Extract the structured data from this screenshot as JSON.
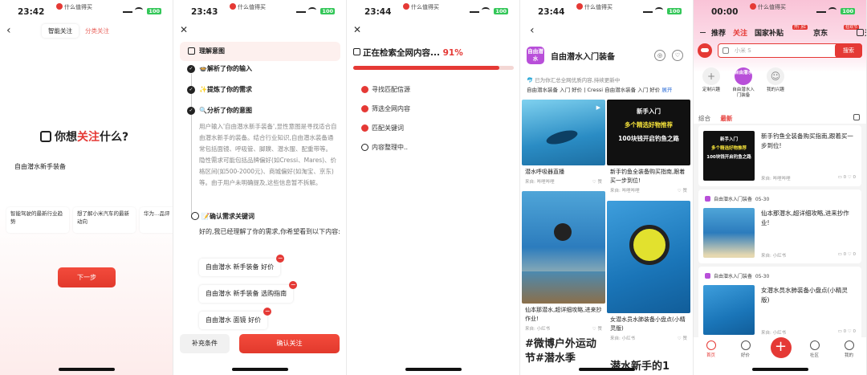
{
  "status_bar": {
    "app": "什么值得买",
    "battery": "100",
    "signal": "5G"
  },
  "screen1": {
    "time": "23:42",
    "tab_active": "智能关注",
    "tab_inactive": "分类关注",
    "heading_pre": "你想",
    "heading_hl": "关注",
    "heading_post": "什么?",
    "input_value": "自由潜水新手装备",
    "chips": [
      "智能驾驶的最新行业趋势",
      "想了解小米汽车的最新动向",
      "华为…品评"
    ],
    "next_label": "下一步"
  },
  "screen2": {
    "time": "23:43",
    "header": "理解意图",
    "step1": "🍲解析了你的输入",
    "step2": "✨提炼了你的需求",
    "step3": "🔍分析了你的意图",
    "desc": "用户输入'自由潜水新手装备',显性意图是寻找适合自由潜水新手的装备。结合行业知识,自由潜水装备通常包括面镜、呼吸管、脚蹼、潜水服、配重带等。隐性需求可能包括品牌偏好(如Cressi、Mares)、价格区间(如500-2000元)、商城偏好(如淘宝、京东)等。由于用户未明确提及,这些信息暂不拆解。",
    "confirm_title": "📝确认需求关键词",
    "confirm_text": "好的,我已经理解了你的需求,你希望看到以下内容:",
    "keywords": [
      "自由潜水 新手装备 好价",
      "自由潜水 新手装备 选购指南",
      "自由潜水 面镜 好价"
    ],
    "add_label": "补充条件",
    "confirm_label": "确认关注"
  },
  "screen3": {
    "time": "23:44",
    "heading": "正在检索全网内容...",
    "percent": "91%",
    "progress": 0.91,
    "items": [
      {
        "label": "寻找匹配信源",
        "done": true
      },
      {
        "label": "筛选全网内容",
        "done": true
      },
      {
        "label": "匹配关键词",
        "done": true
      },
      {
        "label": "内容整理中..",
        "done": false
      }
    ]
  },
  "screen4": {
    "time": "23:44",
    "avatar_text": "自由潜水",
    "title": "自由潜水入门装备",
    "source_line": "已为你汇总全网优质内容,持续更新中",
    "sources": "自由潜水装备 入门 好价 | Cressi 自由潜水装备 入门 好价",
    "expand": "展开",
    "cards": [
      {
        "title": "潜水呼吸器直播",
        "source": "来自: 哔哩哔哩",
        "likes": "赞"
      },
      {
        "title": "新手钓鱼全装备购买指南,跟着买一步到位!",
        "source": "来自: 哔哩哔哩",
        "likes": "赞",
        "cover_1": "新手入门",
        "cover_2": "多个精选好物推荐",
        "cover_3": "100块钱开启钓鱼之路"
      },
      {
        "title": "仙本那潜水,超详细攻略,进来抄作业!",
        "source": "来自: 小红书",
        "likes": "赞"
      },
      {
        "title": "女潜水员水肺装备小盘点(小精灵版)",
        "source": "来自: 小红书",
        "likes": "赞"
      },
      {
        "title": "#微博户外运动节#潜水季"
      },
      {
        "title": "潜水新手的1"
      }
    ]
  },
  "screen5": {
    "time": "00:00",
    "nav": [
      "推荐",
      "关注",
      "国家补贴",
      "京东",
      "天猫"
    ],
    "nav_tags": {
      "京东": "开门红",
      "天猫": "狂欢节"
    },
    "search_placeholder": "小米 S",
    "search_btn": "搜索",
    "shortcuts": [
      "定制兴趣",
      "自由潜水入门装备",
      "我的兴趣"
    ],
    "sub_tabs": [
      "综合",
      "最新"
    ],
    "posts": [
      {
        "title": "新手钓鱼全装备购买指南,跟着买一步到位!",
        "source": "来自: 哔哩哔哩",
        "comments": "0",
        "likes": "0"
      },
      {
        "author": "自由潜水入门装备",
        "date": "05-30",
        "title": "仙本那潜水,超详细攻略,进来抄作业!",
        "source": "来自: 小红书",
        "comments": "0",
        "likes": "0"
      },
      {
        "author": "自由潜水入门装备",
        "date": "05-30",
        "title": "女潜水员水肺装备小盘点(小精灵版)",
        "source": "来自: 小红书",
        "comments": "0",
        "likes": "0"
      }
    ],
    "tabbar": [
      "首页",
      "好价",
      "",
      "社区",
      "我的"
    ]
  }
}
